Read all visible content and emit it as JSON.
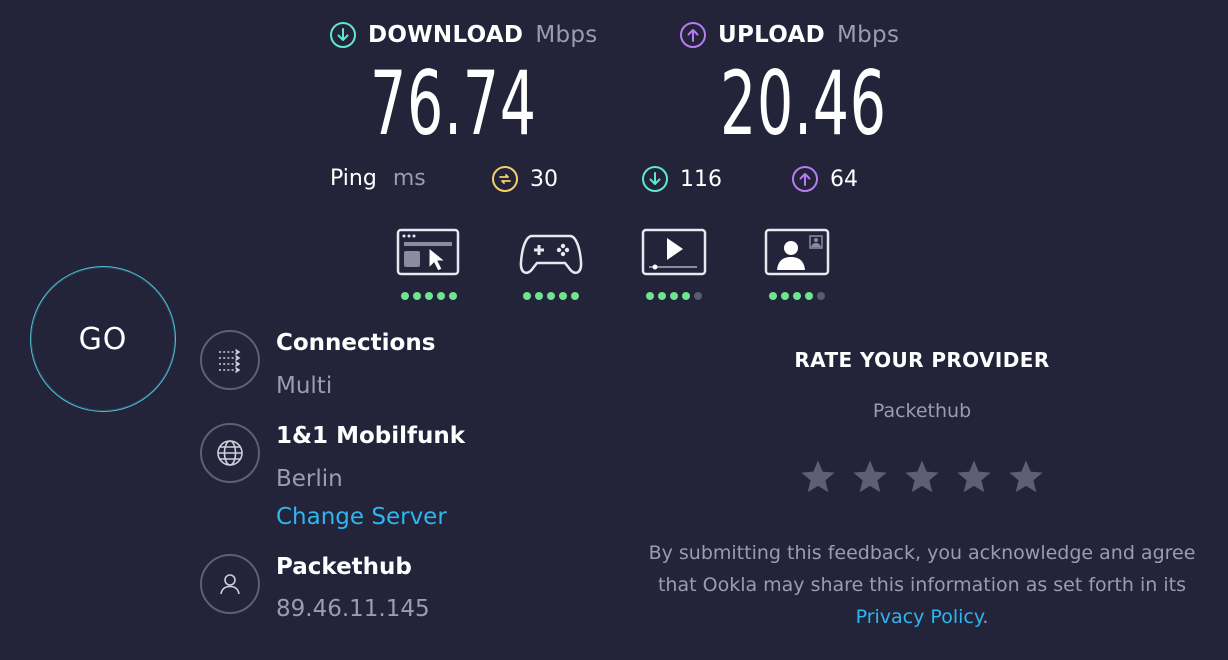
{
  "download": {
    "label": "DOWNLOAD",
    "unit": "Mbps",
    "value": "76.74",
    "icon": "arrow-down-circle-icon",
    "color": "#5fe6d5"
  },
  "upload": {
    "label": "UPLOAD",
    "unit": "Mbps",
    "value": "20.46",
    "icon": "arrow-up-circle-icon",
    "color": "#b77cf0"
  },
  "ping": {
    "label": "Ping",
    "unit": "ms",
    "idle": "30",
    "download": "116",
    "upload": "64",
    "idle_color": "#f2d06b"
  },
  "quality": [
    {
      "name": "web-browsing",
      "icon": "browser-cursor-icon",
      "rating": 5,
      "max": 5
    },
    {
      "name": "gaming",
      "icon": "gamepad-icon",
      "rating": 5,
      "max": 5
    },
    {
      "name": "video-streaming",
      "icon": "video-play-icon",
      "rating": 4,
      "max": 5
    },
    {
      "name": "video-chat",
      "icon": "video-chat-icon",
      "rating": 4,
      "max": 5
    }
  ],
  "go": {
    "label": "GO"
  },
  "connections": {
    "title": "Connections",
    "value": "Multi"
  },
  "server": {
    "title": "1&1 Mobilfunk",
    "location": "Berlin",
    "change_label": "Change Server"
  },
  "client": {
    "title": "Packethub",
    "ip": "89.46.11.145"
  },
  "rate": {
    "title": "RATE YOUR PROVIDER",
    "provider": "Packethub",
    "stars": 5,
    "disclaimer_pre": "By submitting this feedback, you acknowledge and agree that Ookla may share this information as set forth in its ",
    "privacy_link": "Privacy Policy",
    "disclaimer_post": "."
  }
}
